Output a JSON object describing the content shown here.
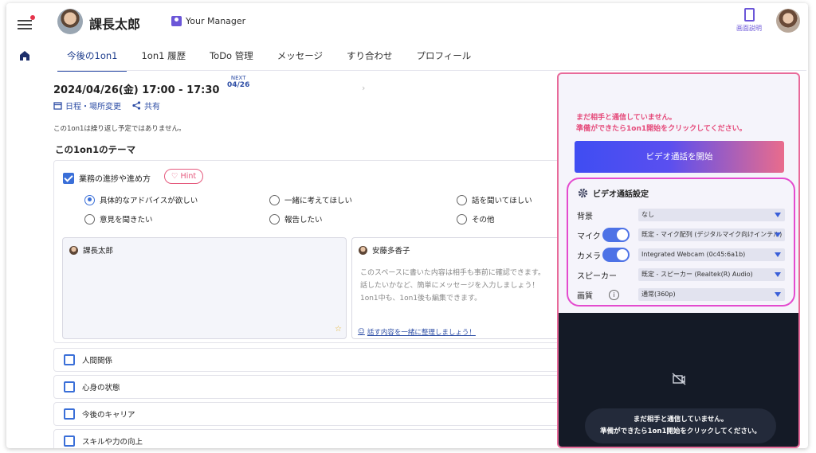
{
  "header": {
    "user_name": "課長太郎",
    "manager_badge": "Your Manager",
    "help_label": "画面説明"
  },
  "tabs": [
    "今後の1on1",
    "1on1 履歴",
    "ToDo 管理",
    "メッセージ",
    "すり合わせ",
    "プロフィール"
  ],
  "session": {
    "datetime": "2024/04/26(金)  17:00 - 17:30",
    "next_label": "NEXT",
    "next_date": "04/26",
    "schedule_link": "日程・場所変更",
    "share_link": "共有",
    "repeat_note": "この1on1は繰り返し予定ではありません。"
  },
  "theme": {
    "heading": "この1on1のテーマ",
    "topic_label": "業務の進捗や進め方",
    "hint_label": "Hint",
    "options": [
      "具体的なアドバイスが欲しい",
      "一緒に考えてほしい",
      "話を聞いてほしい",
      "意見を聞きたい",
      "報告したい",
      "その他"
    ],
    "selected_option": "具体的なアドバイスが欲しい",
    "memo_owner": "課長太郎",
    "memo_partner": "安藤多香子",
    "memo_placeholder_line1": "このスペースに書いた内容は相手も事前に確認できます。",
    "memo_placeholder_line2": "話したいかなど、簡単にメッセージを入力しましょう！",
    "memo_placeholder_line3": "1on1中も、1on1後も編集できます。",
    "memo_footer_link": "話す内容を一緒に整理しましょう！"
  },
  "other_topics": [
    "人間関係",
    "心身の状態",
    "今後のキャリア",
    "スキルや力の向上"
  ],
  "video_panel": {
    "warning_line1": "まだ相手と通信していません。",
    "warning_line2": "準備ができたら1on1開始をクリックしてください。",
    "start_button": "ビデオ通話を開始",
    "settings_title": "ビデオ通話設定",
    "settings": [
      {
        "label": "背景",
        "value": "なし"
      },
      {
        "label": "マイク",
        "value": "既定 - マイク配列 (デジタルマイク向けインテル)",
        "toggle": true
      },
      {
        "label": "カメラ",
        "value": "Integrated Webcam (0c45:6a1b)",
        "toggle": true
      },
      {
        "label": "スピーカー",
        "value": "既定 - スピーカー (Realtek(R) Audio)"
      },
      {
        "label": "画質",
        "value": "通常(360p)"
      }
    ],
    "overlay_line1": "まだ相手と通信していません。",
    "overlay_line2": "準備ができたら1on1開始をクリックしてください。"
  },
  "colors": {
    "accent": "#2f4fa6",
    "warning": "#e54a7a",
    "panel_border": "#e86a9a",
    "settings_border": "#e44bcf",
    "video_bg": "#141a26"
  }
}
